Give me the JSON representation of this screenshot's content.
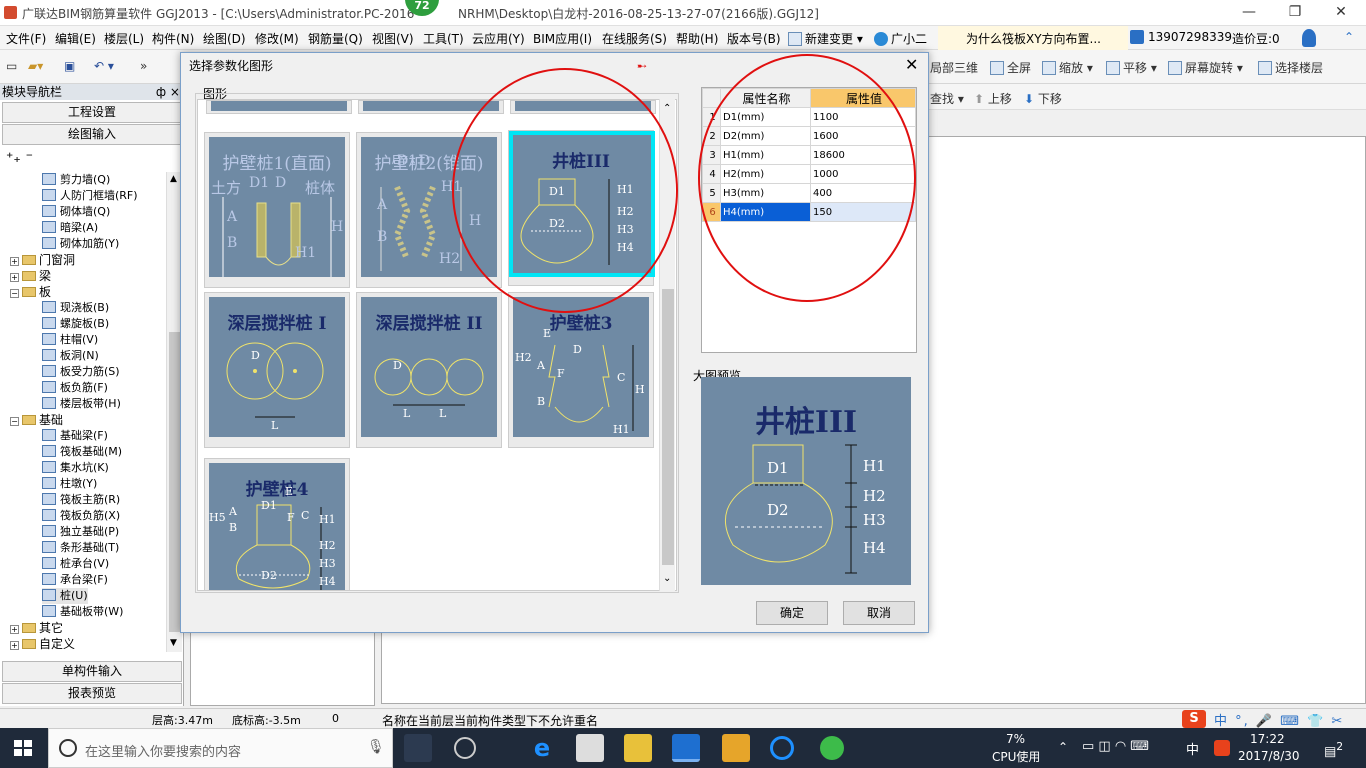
{
  "window": {
    "title": "广联达BIM钢筋算量软件 GGJ2013 - [C:\\Users\\Administrator.PC-2016",
    "title_tail": "NRHM\\Desktop\\白龙村-2016-08-25-13-27-07(2166版).GGJ12]",
    "badge": "72",
    "min": "—",
    "max": "❐",
    "close": "✕"
  },
  "menu": [
    "文件(F)",
    "编辑(E)",
    "楼层(L)",
    "构件(N)",
    "绘图(D)",
    "修改(M)",
    "钢筋量(Q)",
    "视图(V)",
    "工具(T)",
    "云应用(Y)",
    "BIM应用(I)",
    "在线服务(S)",
    "帮助(H)",
    "版本号(B)"
  ],
  "menu_right": {
    "change": "新建变更",
    "assistant": "广小二",
    "question": "为什么筏板XY方向布置...",
    "phone": "13907298339",
    "beans": "造价豆:0"
  },
  "toolbar": {
    "local3d": "局部三维",
    "fullscreen": "全屏",
    "zoom": "缩放",
    "pan": "平移",
    "rotate": "屏幕旋转",
    "select_floor": "选择楼层",
    "find": "查找",
    "up": "上移",
    "down": "下移"
  },
  "nav": {
    "header": "模块导航栏",
    "pin": "ф  ×",
    "project_settings": "工程设置",
    "drawing_input": "绘图输入",
    "single_input": "单构件输入",
    "report_preview": "报表预览"
  },
  "tree": [
    {
      "t": "剪力墙(Q)",
      "kind": "item",
      "level": 2
    },
    {
      "t": "人防门框墙(RF)",
      "kind": "item",
      "level": 2
    },
    {
      "t": "砌体墙(Q)",
      "kind": "item",
      "level": 2
    },
    {
      "t": "暗梁(A)",
      "kind": "item",
      "level": 2
    },
    {
      "t": "砌体加筋(Y)",
      "kind": "item",
      "level": 2
    },
    {
      "t": "门窗洞",
      "kind": "cat",
      "exp": "+"
    },
    {
      "t": "梁",
      "kind": "cat",
      "exp": "+"
    },
    {
      "t": "板",
      "kind": "cat",
      "exp": "−"
    },
    {
      "t": "现浇板(B)",
      "kind": "item",
      "level": 2
    },
    {
      "t": "螺旋板(B)",
      "kind": "item",
      "level": 2
    },
    {
      "t": "柱帽(V)",
      "kind": "item",
      "level": 2
    },
    {
      "t": "板洞(N)",
      "kind": "item",
      "level": 2
    },
    {
      "t": "板受力筋(S)",
      "kind": "item",
      "level": 2
    },
    {
      "t": "板负筋(F)",
      "kind": "item",
      "level": 2
    },
    {
      "t": "楼层板带(H)",
      "kind": "item",
      "level": 2
    },
    {
      "t": "基础",
      "kind": "cat",
      "exp": "−"
    },
    {
      "t": "基础梁(F)",
      "kind": "item",
      "level": 2
    },
    {
      "t": "筏板基础(M)",
      "kind": "item",
      "level": 2
    },
    {
      "t": "集水坑(K)",
      "kind": "item",
      "level": 2
    },
    {
      "t": "柱墩(Y)",
      "kind": "item",
      "level": 2
    },
    {
      "t": "筏板主筋(R)",
      "kind": "item",
      "level": 2
    },
    {
      "t": "筏板负筋(X)",
      "kind": "item",
      "level": 2
    },
    {
      "t": "独立基础(P)",
      "kind": "item",
      "level": 2
    },
    {
      "t": "条形基础(T)",
      "kind": "item",
      "level": 2
    },
    {
      "t": "桩承台(V)",
      "kind": "item",
      "level": 2
    },
    {
      "t": "承台梁(F)",
      "kind": "item",
      "level": 2
    },
    {
      "t": "桩(U)",
      "kind": "item",
      "level": 2
    },
    {
      "t": "基础板带(W)",
      "kind": "item",
      "level": 2
    },
    {
      "t": "其它",
      "kind": "cat",
      "exp": "+"
    },
    {
      "t": "自定义",
      "kind": "cat",
      "exp": "+"
    }
  ],
  "dialog": {
    "title": "选择参数化图形",
    "close": "✕",
    "group_label": "图形",
    "shapes": [
      {
        "name": "护壁桩1(直面)",
        "labels": [
          "土方",
          "D1",
          "D",
          "桩体",
          "A",
          "B",
          "H",
          "H1"
        ]
      },
      {
        "name": "护壁桩2(锥面)",
        "labels": [
          "D1",
          "D",
          "H1",
          "A",
          "B",
          "H",
          "H2"
        ]
      },
      {
        "name": "井桩III",
        "labels": [
          "D1",
          "D2",
          "H1",
          "H2",
          "H3",
          "H4"
        ]
      },
      {
        "name": "深层搅拌桩 I",
        "labels": [
          "D",
          "L"
        ]
      },
      {
        "name": "深层搅拌桩 II",
        "labels": [
          "D",
          "L",
          "L"
        ]
      },
      {
        "name": "护壁桩3",
        "labels": [
          "E",
          "D",
          "H2",
          "A",
          "F",
          "C",
          "H",
          "B",
          "H1"
        ]
      },
      {
        "name": "护壁桩4",
        "labels": [
          "E",
          "H5",
          "A",
          "B",
          "D1",
          "F",
          "C",
          "H1",
          "H2",
          "H3",
          "H4",
          "D2"
        ]
      }
    ],
    "table": {
      "col_name": "属性名称",
      "col_value": "属性值",
      "rows": [
        {
          "n": "1",
          "name": "D1(mm)",
          "value": "1100"
        },
        {
          "n": "2",
          "name": "D2(mm)",
          "value": "1600"
        },
        {
          "n": "3",
          "name": "H1(mm)",
          "value": "18600"
        },
        {
          "n": "4",
          "name": "H2(mm)",
          "value": "1000"
        },
        {
          "n": "5",
          "name": "H3(mm)",
          "value": "400"
        },
        {
          "n": "6",
          "name": "H4(mm)",
          "value": "150"
        }
      ]
    },
    "preview_label": "大图预览",
    "preview_title": "井桩III",
    "preview_labels": [
      "D1",
      "D2",
      "H1",
      "H2",
      "H3",
      "H4"
    ],
    "ok": "确定",
    "cancel": "取消"
  },
  "status": {
    "floor_height": "层高:3.47m",
    "base_height": "底标高:-3.5m",
    "zero": "0",
    "message": "名称在当前层当前构件类型下不允许重名"
  },
  "taskbar": {
    "search_placeholder": "在这里输入你要搜索的内容",
    "cpu": "7%",
    "cpu_label": "CPU使用",
    "ime": "中",
    "time": "17:22",
    "date": "2017/8/30",
    "notif": "2"
  },
  "tray_ime": "中 °, 🎤 ⌨ 👕 ✂"
}
